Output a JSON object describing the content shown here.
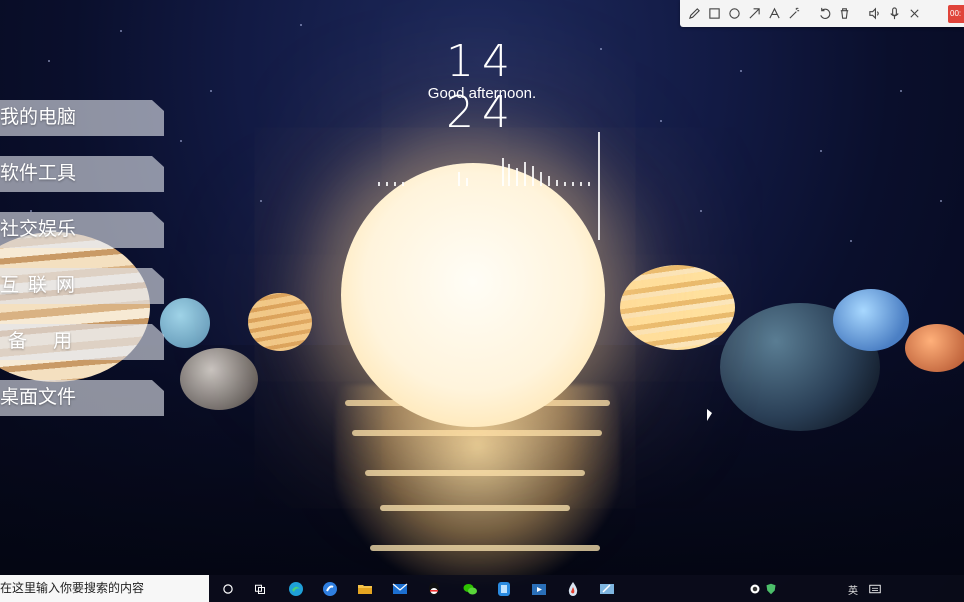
{
  "clock": {
    "time": "14 24",
    "greeting": "Good afternoon."
  },
  "side_menu": [
    {
      "label": "我的电脑"
    },
    {
      "label": "软件工具"
    },
    {
      "label": "社交娱乐"
    },
    {
      "label": "互联网"
    },
    {
      "label": "备用"
    },
    {
      "label": "桌面文件"
    }
  ],
  "toolbar": {
    "tools": [
      "pencil-icon",
      "rectangle-icon",
      "circle-icon",
      "arrow-icon",
      "text-icon",
      "magic-wand-icon",
      "undo-icon",
      "trash-icon",
      "speaker-icon",
      "microphone-icon",
      "close-icon"
    ],
    "recording_label": "00:",
    "recording_color": "#e0443a"
  },
  "taskbar": {
    "search_placeholder": "在这里输入你要搜索的内容",
    "pinned": [
      "cortana-icon",
      "task-view-icon",
      "edge-icon",
      "sogou-browser-icon",
      "file-explorer-icon",
      "mail-icon",
      "qq-icon",
      "wechat-icon",
      "phone-link-icon",
      "media-player-icon",
      "droplet-app-icon",
      "pen-tablet-icon"
    ],
    "tray": [
      "security-icon",
      "shield-icon"
    ],
    "ime_label": "英"
  }
}
